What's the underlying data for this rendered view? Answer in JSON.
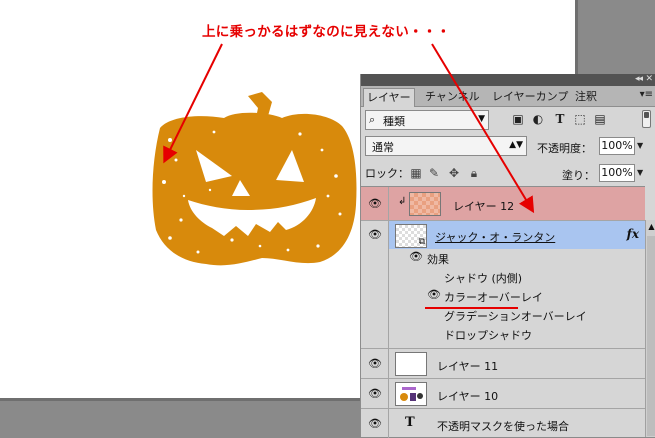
{
  "annotation": {
    "text": "上に乗っかるはずなのに見えない・・・",
    "color": "#e60000"
  },
  "canvas": {
    "background": "#ffffff",
    "pumpkin_color": "#d88a0c"
  },
  "panel": {
    "tabs": [
      "レイヤー",
      "チャンネル",
      "レイヤーカンプ",
      "注釈"
    ],
    "active_tab": "レイヤー",
    "filter_kind": "種類",
    "blend_mode": "通常",
    "opacity_label": "不透明度：",
    "opacity_value": "100%",
    "lock_label": "ロック：",
    "fill_label": "塗り：",
    "fill_value": "100%",
    "icons": {
      "search": "🔍",
      "filter_pixel": "image-icon",
      "filter_adjust": "adjustment-icon",
      "filter_type": "T",
      "filter_shape": "shape-icon",
      "filter_smart": "smart-object-icon"
    }
  },
  "layers": [
    {
      "name": "レイヤー 12",
      "visible": true,
      "clipped": true,
      "selected_style": "red"
    },
    {
      "name": "ジャック・オ・ランタン",
      "visible": true,
      "has_fx": true,
      "fx_label": "fx",
      "effects_label": "効果",
      "effects": [
        "シャドウ (内側)",
        "カラーオーバーレイ",
        "グラデーションオーバーレイ",
        "ドロップシャドウ"
      ]
    },
    {
      "name": "レイヤー 11",
      "visible": true
    },
    {
      "name": "レイヤー 10",
      "visible": true
    },
    {
      "name": "不透明マスクを使った場合",
      "visible": true,
      "type_layer": true,
      "type_glyph": "T"
    }
  ]
}
